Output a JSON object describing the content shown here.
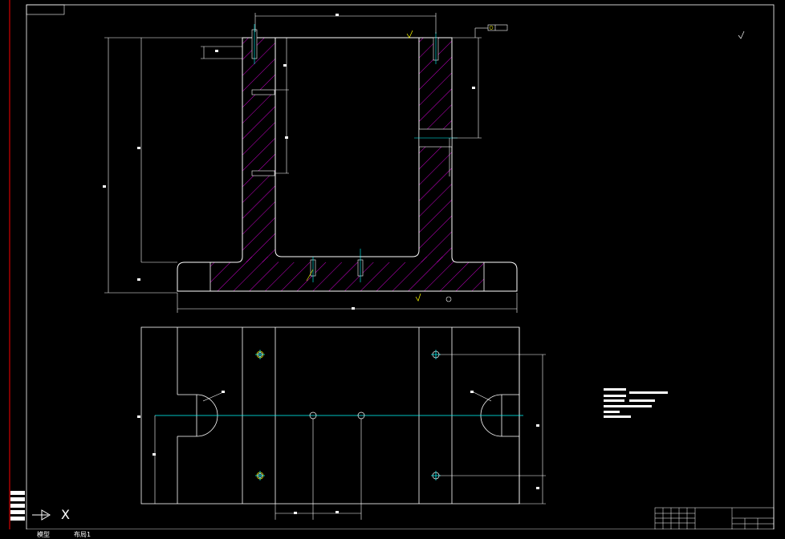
{
  "drawing": {
    "background": "#000000",
    "line_color": "#ffffff",
    "hatch_color": "#ff00ff",
    "center_line_color": "#00ffff",
    "border_color": "#ff0000",
    "note_color": "#ffff00"
  },
  "ucs": {
    "x_label": "X"
  },
  "tabs": [
    {
      "label": "模型"
    },
    {
      "label": "布局1"
    }
  ]
}
